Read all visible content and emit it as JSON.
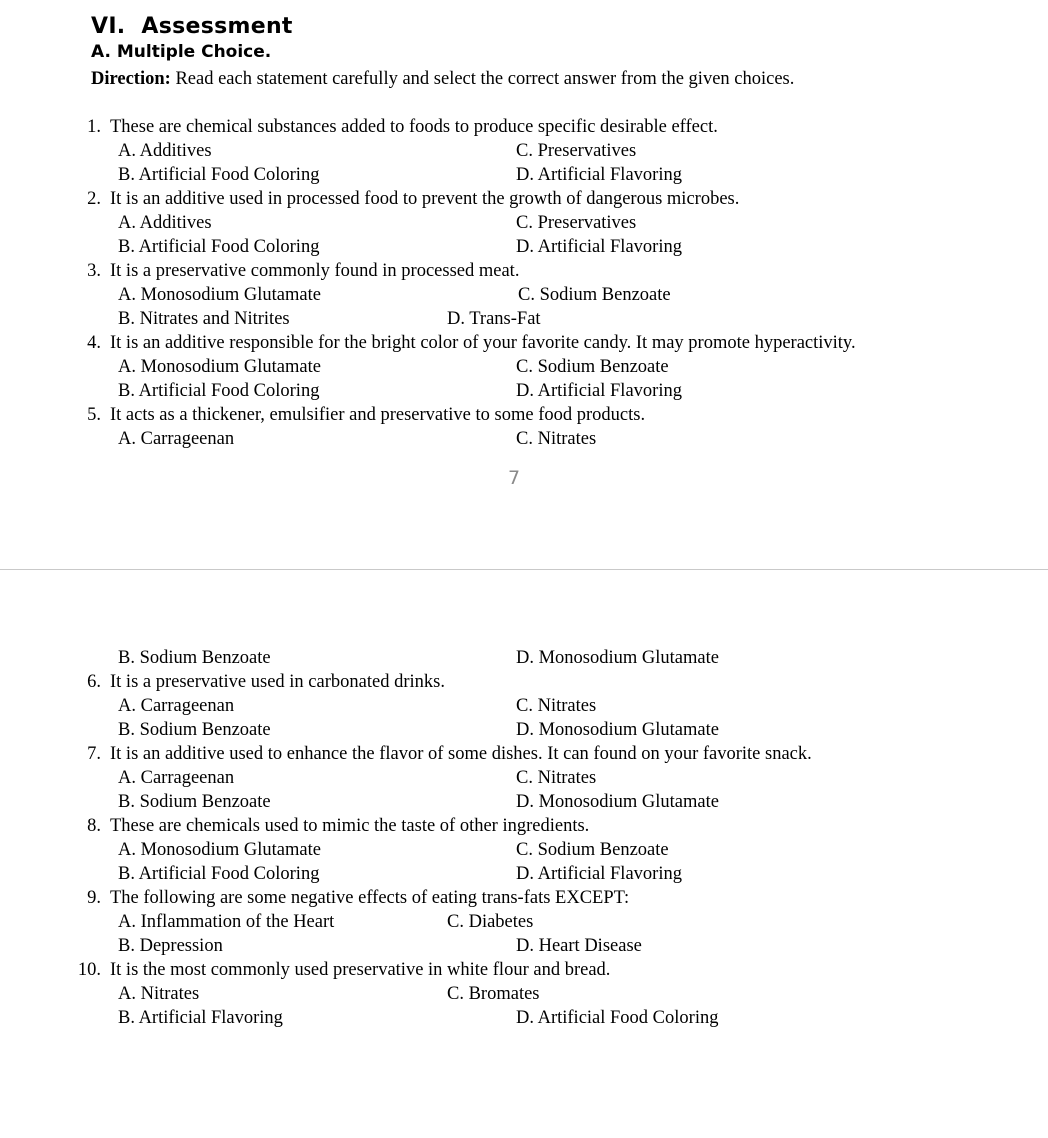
{
  "document": {
    "heading": "VI.  Assessment",
    "section": "A. Multiple Choice.",
    "direction_label": "Direction:",
    "direction_text": " Read each statement carefully and select the correct answer from the given choices.",
    "page_number": "7"
  },
  "questions": [
    {
      "number": "1.",
      "text": "These are chemical substances added to foods to produce specific desirable effect.",
      "rows": [
        {
          "left": "A. Additives",
          "right": "C. Preservatives",
          "right_offset": "std"
        },
        {
          "left": "B. Artificial Food Coloring",
          "right": "D. Artificial Flavoring",
          "right_offset": "std"
        }
      ]
    },
    {
      "number": "2.",
      "text": "It is an additive used in processed food to prevent the growth of dangerous microbes.",
      "rows": [
        {
          "left": "A. Additives",
          "right": "C. Preservatives",
          "right_offset": "std"
        },
        {
          "left": "B. Artificial Food Coloring",
          "right": "D. Artificial Flavoring",
          "right_offset": "std"
        }
      ]
    },
    {
      "number": "3.",
      "text": "It is a preservative commonly found in processed meat.",
      "rows": [
        {
          "left": "A. Monosodium Glutamate",
          "right": "C. Sodium Benzoate",
          "right_offset": "wide"
        },
        {
          "left": "B. Nitrates and Nitrites",
          "right": "D. Trans-Fat",
          "right_offset": "near"
        }
      ]
    },
    {
      "number": "4.",
      "text": "It is an additive responsible for the bright color of your favorite candy. It may promote hyperactivity.",
      "rows": [
        {
          "left": "A. Monosodium Glutamate",
          "right": "C. Sodium Benzoate",
          "right_offset": "std"
        },
        {
          "left": "B. Artificial Food Coloring",
          "right": "D. Artificial Flavoring",
          "right_offset": "std"
        }
      ]
    },
    {
      "number": "5.",
      "text": "It acts as a thickener, emulsifier and preservative to some food products.",
      "rows": [
        {
          "left": "A. Carrageenan",
          "right": "C. Nitrates",
          "right_offset": "std"
        }
      ],
      "rows_after_break": [
        {
          "left": "B. Sodium Benzoate",
          "right": "D. Monosodium Glutamate",
          "right_offset": "std"
        }
      ]
    },
    {
      "number": "6.",
      "text": "It is a preservative used in carbonated drinks.",
      "rows": [
        {
          "left": "A. Carrageenan",
          "right": "C. Nitrates",
          "right_offset": "std"
        },
        {
          "left": "B. Sodium Benzoate",
          "right": "D. Monosodium Glutamate",
          "right_offset": "std"
        }
      ]
    },
    {
      "number": "7.",
      "text": "It is an additive used to enhance the flavor of some dishes. It can found on your favorite snack.",
      "rows": [
        {
          "left": "A. Carrageenan",
          "right": "C. Nitrates",
          "right_offset": "std"
        },
        {
          "left": "B. Sodium Benzoate",
          "right": "D. Monosodium Glutamate",
          "right_offset": "std"
        }
      ]
    },
    {
      "number": "8.",
      "text": "These are chemicals used to mimic the taste of other ingredients.",
      "rows": [
        {
          "left": "A. Monosodium Glutamate",
          "right": "C. Sodium Benzoate",
          "right_offset": "std"
        },
        {
          "left": "B. Artificial Food Coloring",
          "right": "D. Artificial Flavoring",
          "right_offset": "std"
        }
      ]
    },
    {
      "number": "9.",
      "text": "The following are some negative effects of eating trans-fats EXCEPT:",
      "rows": [
        {
          "left": "A. Inflammation of the Heart",
          "right": "C. Diabetes",
          "right_offset": "near"
        },
        {
          "left": "B. Depression",
          "right": "D. Heart Disease",
          "right_offset": "std"
        }
      ]
    },
    {
      "number": "10.",
      "text": "It is the most commonly used preservative in white flour and bread.",
      "rows": [
        {
          "left": "A. Nitrates",
          "right": "C. Bromates",
          "right_offset": "near"
        },
        {
          "left": "B. Artificial Flavoring",
          "right": "D. Artificial Food Coloring",
          "right_offset": "std"
        }
      ]
    }
  ],
  "colors": {
    "text": "#000000",
    "page_number": "#8a8a8a",
    "page_break": "#c9c9c9",
    "background": "#ffffff"
  }
}
